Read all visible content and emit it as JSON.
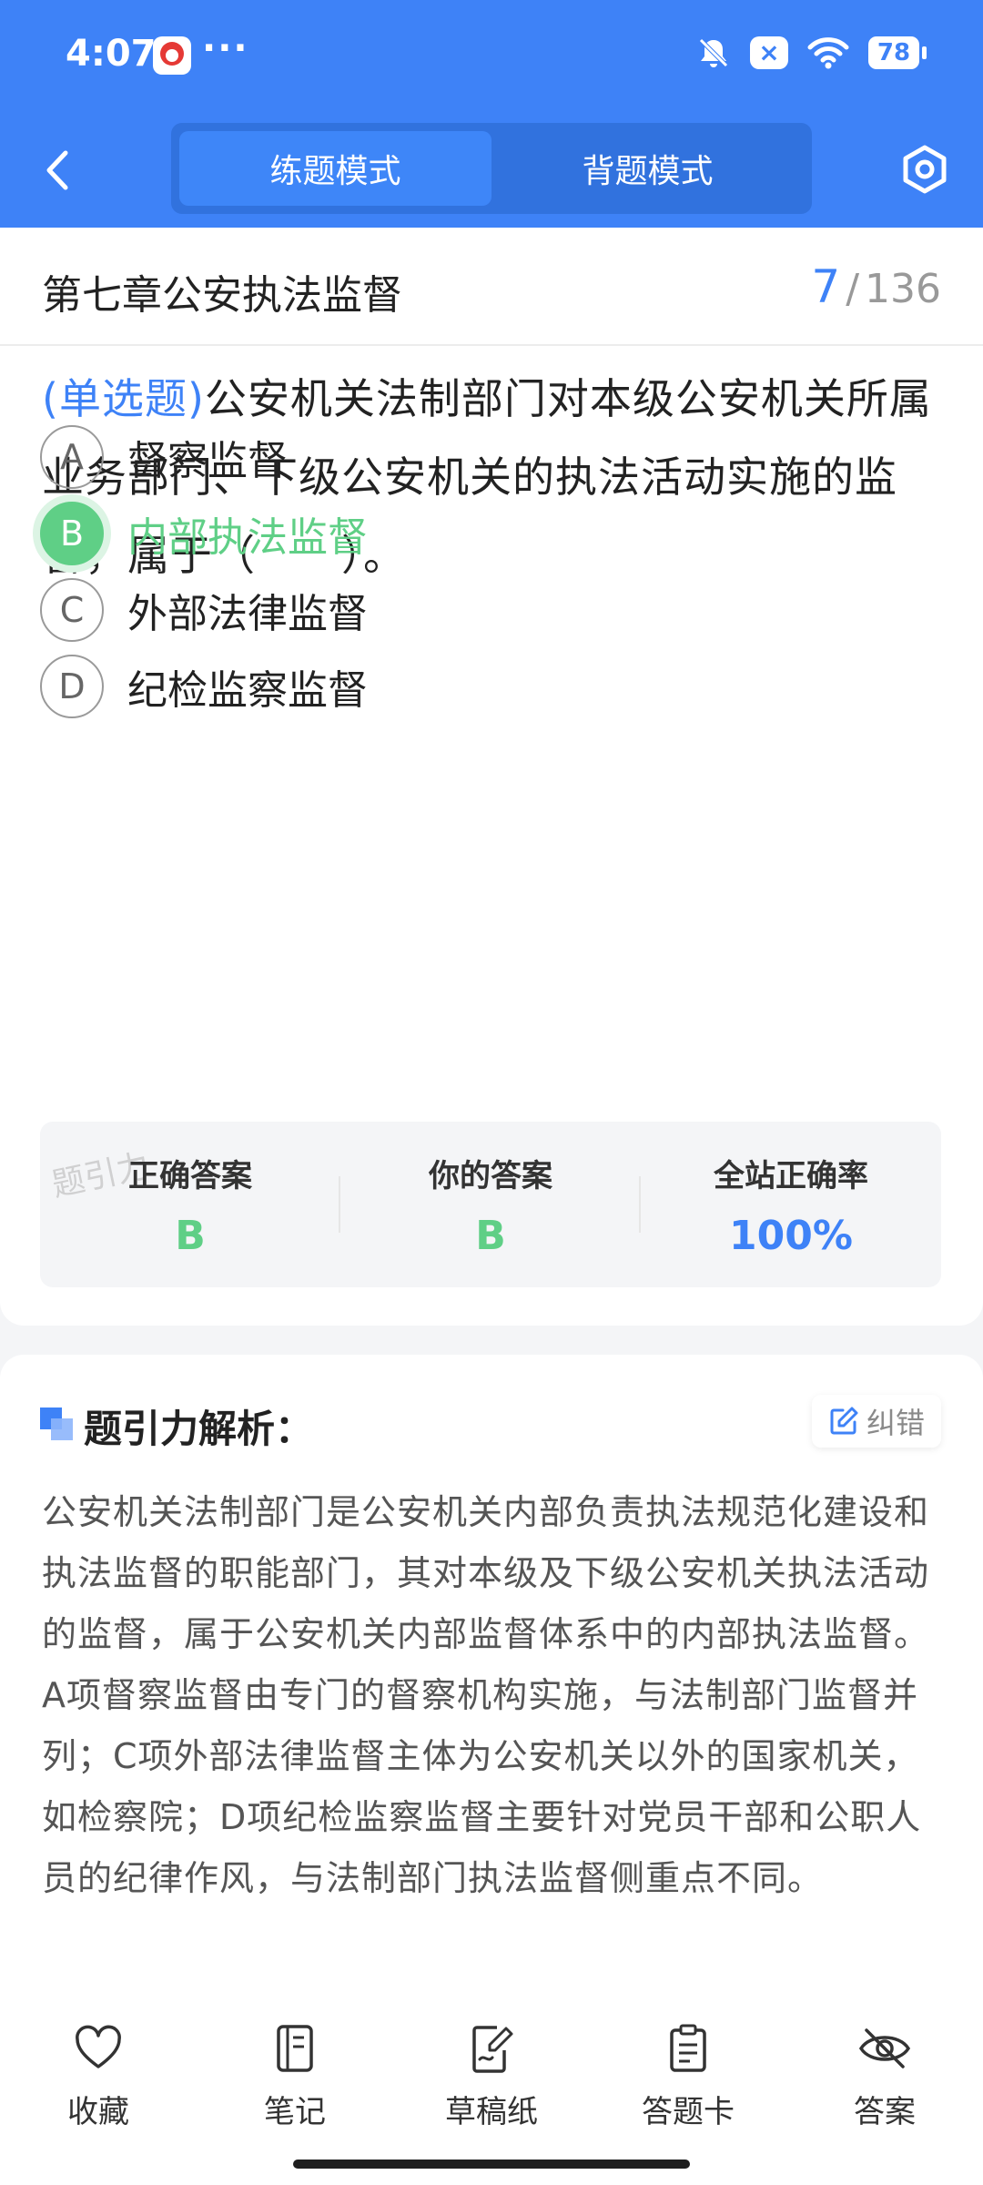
{
  "status": {
    "time": "4:07",
    "dots": "···",
    "battery": "78",
    "x_badge": "×"
  },
  "header": {
    "tabs": [
      {
        "label": "练题模式",
        "active": true
      },
      {
        "label": "背题模式",
        "active": false
      }
    ]
  },
  "question": {
    "chapter": "第七章公安执法监督",
    "current": "7",
    "separator": "/",
    "total": "136",
    "type": "(单选题)",
    "text": "公安机关法制部门对本级公安机关所属业务部门、下级公安机关的执法活动实施的监督，属于（　　）。",
    "options": [
      {
        "letter": "A",
        "text": "督察监督"
      },
      {
        "letter": "B",
        "text": "内部执法监督",
        "correct": true
      },
      {
        "letter": "C",
        "text": "外部法律监督"
      },
      {
        "letter": "D",
        "text": "纪检监察监督"
      }
    ]
  },
  "answers": {
    "correct_label": "正确答案",
    "correct_value": "B",
    "yours_label": "你的答案",
    "yours_value": "B",
    "rate_label": "全站正确率",
    "rate_value": "100%",
    "watermark": "题引力"
  },
  "analysis": {
    "title": "题引力解析：",
    "error_button": "纠错",
    "text": "公安机关法制部门是公安机关内部负责执法规范化建设和执法监督的职能部门，其对本级及下级公安机关执法活动的监督，属于公安机关内部监督体系中的内部执法监督。A项督察监督由专门的督察机构实施，与法制部门监督并列；C项外部法律监督主体为公安机关以外的国家机关，如检察院；D项纪检监察监督主要针对党员干部和公职人员的纪律作风，与法制部门执法监督侧重点不同。"
  },
  "bottom_bar": [
    {
      "icon": "heart-icon",
      "label": "收藏"
    },
    {
      "icon": "notebook-icon",
      "label": "笔记"
    },
    {
      "icon": "draft-paper-icon",
      "label": "草稿纸"
    },
    {
      "icon": "answer-sheet-icon",
      "label": "答题卡"
    },
    {
      "icon": "eye-slash-icon",
      "label": "答案"
    }
  ],
  "colors": {
    "primary": "#3e82f7",
    "correct": "#5fcf86"
  }
}
